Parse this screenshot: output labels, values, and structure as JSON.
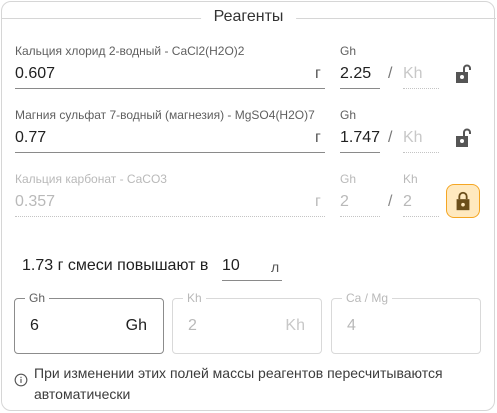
{
  "title": "Реагенты",
  "reagents": [
    {
      "name": "Кальция хлорид 2-водный - CaCl2(H2O)2",
      "mass": "0.607",
      "mass_unit": "г",
      "gh_label": "Gh",
      "gh_value": "2.25",
      "kh_label": "",
      "kh_placeholder": "Kh",
      "locked": false,
      "disabled": false
    },
    {
      "name": "Магния сульфат 7-водный (магнезия) - MgSO4(H2O)7",
      "mass": "0.77",
      "mass_unit": "г",
      "gh_label": "Gh",
      "gh_value": "1.747",
      "kh_label": "",
      "kh_placeholder": "Kh",
      "locked": false,
      "disabled": false
    },
    {
      "name": "Кальция карбонат - CaCO3",
      "mass": "0.357",
      "mass_unit": "г",
      "gh_label": "Gh",
      "gh_value": "2",
      "kh_label": "Kh",
      "kh_value": "2",
      "locked": true,
      "disabled": true
    }
  ],
  "separator": "/",
  "mix": {
    "text": "1.73 г смеси повышают в",
    "volume": "10",
    "volume_unit": "л"
  },
  "targets": [
    {
      "label": "Gh",
      "value": "6",
      "unit": "Gh",
      "active": true
    },
    {
      "label": "Kh",
      "value": "2",
      "unit": "Kh",
      "active": false
    },
    {
      "label": "Ca / Mg",
      "value": "4",
      "unit": "",
      "active": false
    }
  ],
  "info": "При изменении этих полей массы реагентов пересчитываются автоматически",
  "colors": {
    "accent_lock_bg": "#ffe9bf",
    "accent_lock_border": "#f5a623",
    "text": "#212121",
    "disabled_text": "#b9b9b9"
  },
  "icons": {
    "unlocked": "lock-open-icon",
    "locked": "lock-closed-icon",
    "info": "info-icon"
  }
}
